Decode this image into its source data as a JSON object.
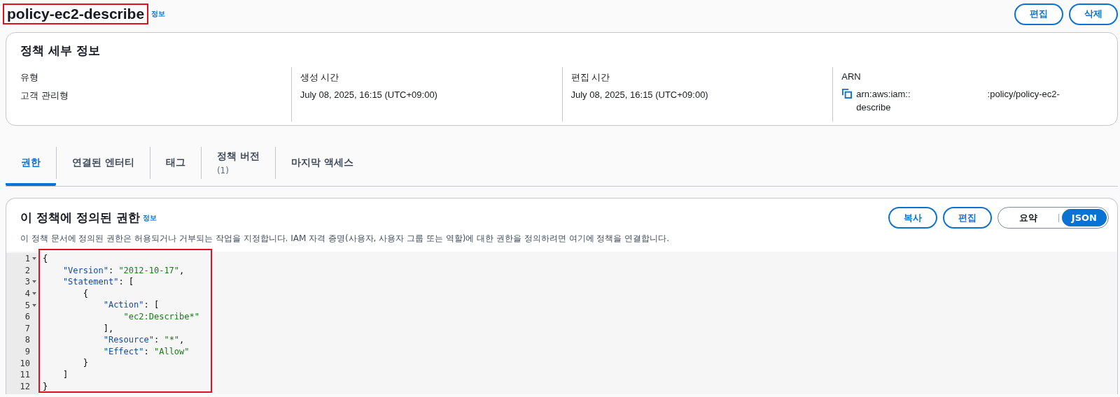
{
  "header": {
    "title": "policy-ec2-describe",
    "highlighted": true,
    "info_link": "정보",
    "buttons": [
      "편집",
      "삭제"
    ]
  },
  "details": {
    "title": "정책 세부 정보",
    "fields": [
      {
        "label": "유형",
        "value": "고객 관리형",
        "kind": "text"
      },
      {
        "label": "생성 시간",
        "value": "July 08, 2025, 16:15 (UTC+09:00)",
        "kind": "text"
      },
      {
        "label": "편집 시간",
        "value": "July 08, 2025, 16:15 (UTC+09:00)",
        "kind": "text"
      },
      {
        "label": "ARN",
        "value_start": "arn:aws:iam::",
        "value_end": ":policy/policy-ec2-describe",
        "kind": "copy"
      }
    ]
  },
  "tabs": [
    {
      "label": "권한",
      "selected": true
    },
    {
      "label": "연결된 엔터티",
      "selected": false
    },
    {
      "label": "태그",
      "selected": false
    },
    {
      "label": "정책 버전",
      "count": "(1)",
      "selected": false
    },
    {
      "label": "마지막 액세스",
      "selected": false
    }
  ],
  "permissions": {
    "title": "이 정책에 정의된 권한",
    "info_link": "정보",
    "description": "이 정책 문서에 정의된 권한은 허용되거나 거부되는 작업을 지정합니다. IAM 자격 증명(사용자, 사용자 그룹 또는 역할)에 대한 권한을 정의하려면 여기에 정책을 연결합니다.",
    "buttons": [
      "복사",
      "편집"
    ],
    "view_toggle": [
      {
        "label": "요약",
        "selected": false
      },
      {
        "label": "JSON",
        "selected": true
      }
    ],
    "editor": {
      "highlighted": true,
      "lines": [
        {
          "number": "1",
          "foldable": true,
          "tokens": [
            {
              "kind": "punct",
              "text": "{"
            }
          ]
        },
        {
          "number": "2",
          "foldable": false,
          "tokens": [
            {
              "kind": "key",
              "text": "    \"Version\""
            },
            {
              "kind": "punct",
              "text": ": "
            },
            {
              "kind": "string",
              "text": "\"2012-10-17\""
            },
            {
              "kind": "punct",
              "text": ","
            }
          ]
        },
        {
          "number": "3",
          "foldable": true,
          "tokens": [
            {
              "kind": "key",
              "text": "    \"Statement\""
            },
            {
              "kind": "punct",
              "text": ": ["
            }
          ]
        },
        {
          "number": "4",
          "foldable": true,
          "tokens": [
            {
              "kind": "punct",
              "text": "        {"
            }
          ]
        },
        {
          "number": "5",
          "foldable": true,
          "tokens": [
            {
              "kind": "key",
              "text": "            \"Action\""
            },
            {
              "kind": "punct",
              "text": ": ["
            }
          ]
        },
        {
          "number": "6",
          "foldable": false,
          "tokens": [
            {
              "kind": "string",
              "text": "                \"ec2:Describe*\""
            }
          ]
        },
        {
          "number": "7",
          "foldable": false,
          "tokens": [
            {
              "kind": "punct",
              "text": "            ],"
            }
          ]
        },
        {
          "number": "8",
          "foldable": false,
          "tokens": [
            {
              "kind": "key",
              "text": "            \"Resource\""
            },
            {
              "kind": "punct",
              "text": ": "
            },
            {
              "kind": "string",
              "text": "\"*\""
            },
            {
              "kind": "punct",
              "text": ","
            }
          ]
        },
        {
          "number": "9",
          "foldable": false,
          "tokens": [
            {
              "kind": "key",
              "text": "            \"Effect\""
            },
            {
              "kind": "punct",
              "text": ": "
            },
            {
              "kind": "string",
              "text": "\"Allow\""
            }
          ]
        },
        {
          "number": "10",
          "foldable": false,
          "tokens": [
            {
              "kind": "punct",
              "text": "        }"
            }
          ]
        },
        {
          "number": "11",
          "foldable": false,
          "tokens": [
            {
              "kind": "punct",
              "text": "    ]"
            }
          ]
        },
        {
          "number": "12",
          "foldable": false,
          "tokens": [
            {
              "kind": "punct",
              "text": "}"
            }
          ]
        }
      ]
    }
  }
}
